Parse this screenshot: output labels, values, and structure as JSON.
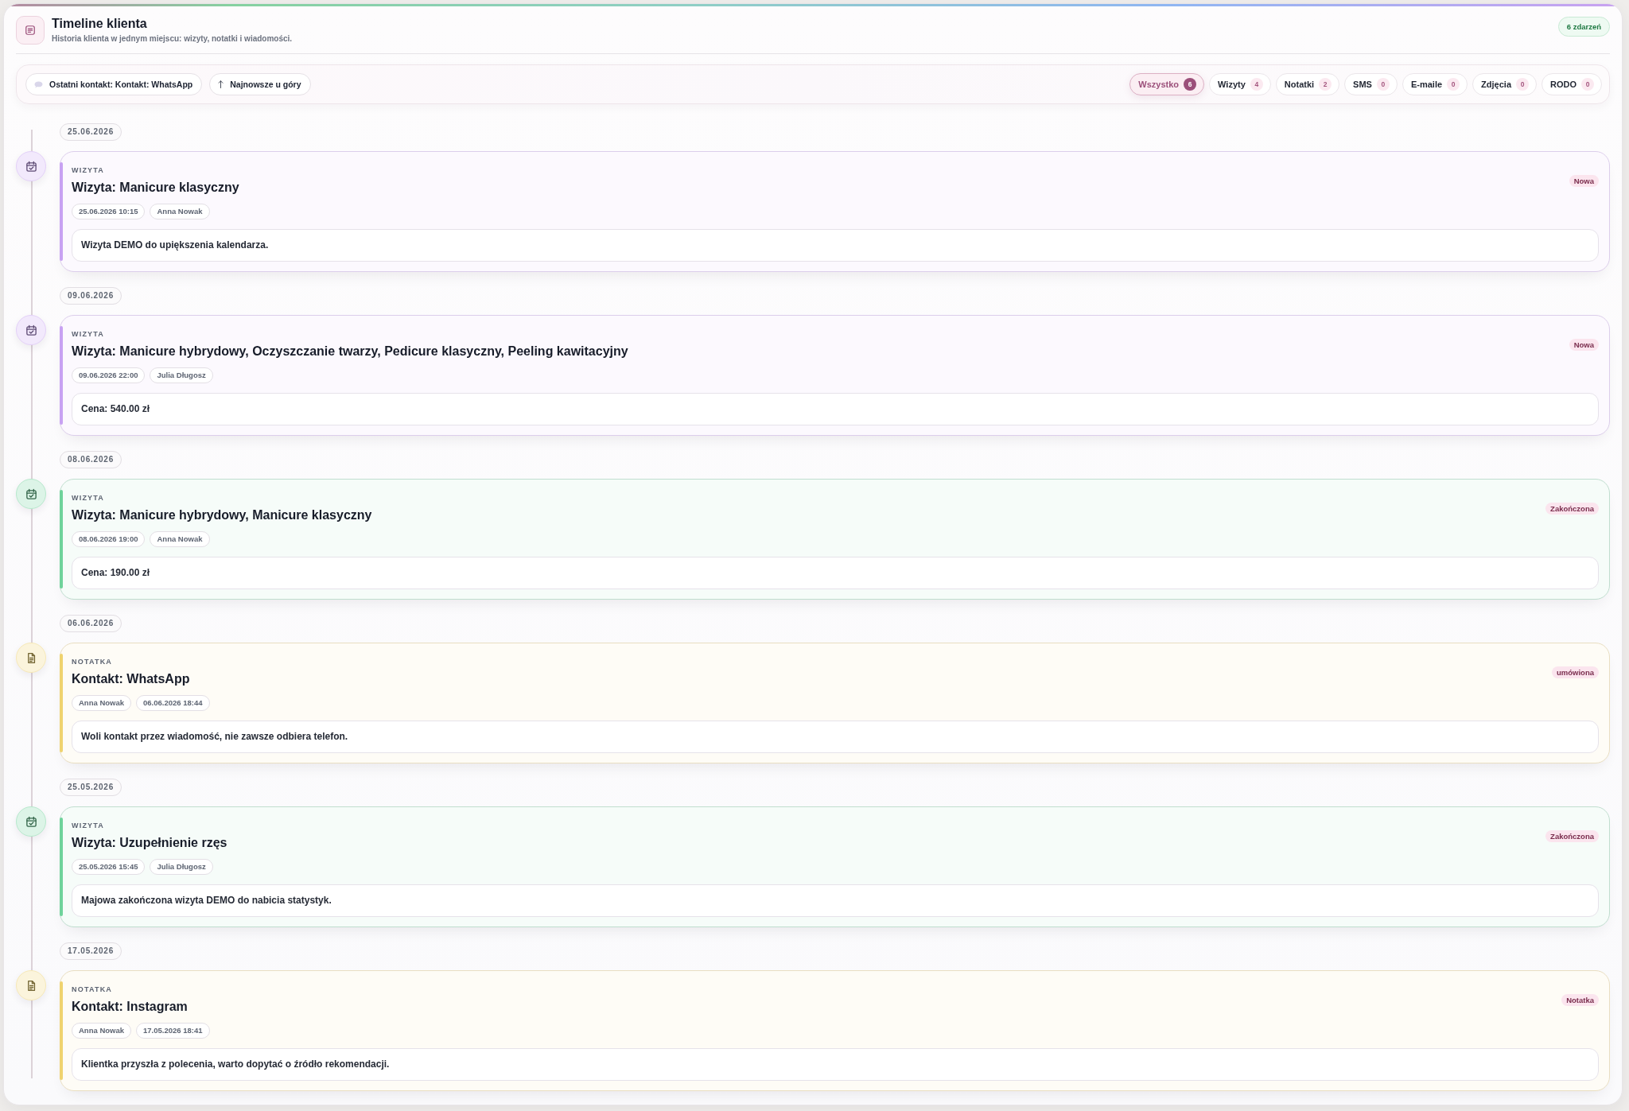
{
  "header": {
    "title": "Timeline klienta",
    "subtitle": "Historia klienta w jednym miejscu: wizyty, notatki i wiadomości.",
    "count_badge": "6 zdarzeń"
  },
  "toolbar": {
    "last_contact": "Ostatni kontakt: Kontakt: WhatsApp",
    "sort": "Najnowsze u góry",
    "filters": [
      {
        "label": "Wszystko",
        "count": "6",
        "selected": true
      },
      {
        "label": "Wizyty",
        "count": "4",
        "selected": false
      },
      {
        "label": "Notatki",
        "count": "2",
        "selected": false
      },
      {
        "label": "SMS",
        "count": "0",
        "selected": false
      },
      {
        "label": "E-maile",
        "count": "0",
        "selected": false
      },
      {
        "label": "Zdjęcia",
        "count": "0",
        "selected": false
      },
      {
        "label": "RODO",
        "count": "0",
        "selected": false
      }
    ]
  },
  "timeline": [
    {
      "date": "25.06.2026",
      "kind": "visit",
      "type_label": "WIZYTA",
      "title": "Wizyta: Manicure klasyczny",
      "status": "Nowa",
      "color": "#c8a2f2",
      "chips": [
        "25.06.2026 10:15",
        "Anna Nowak"
      ],
      "body": "Wizyta DEMO do upiększenia kalendarza."
    },
    {
      "date": "09.06.2026",
      "kind": "visit",
      "type_label": "WIZYTA",
      "title": "Wizyta: Manicure hybrydowy, Oczyszczanie twarzy, Pedicure klasyczny, Peeling kawitacyjny",
      "status": "Nowa",
      "color": "#c8a2f2",
      "chips": [
        "09.06.2026 22:00",
        "Julia Długosz"
      ],
      "body": "Cena: 540.00 zł"
    },
    {
      "date": "08.06.2026",
      "kind": "visit",
      "type_label": "WIZYTA",
      "title": "Wizyta: Manicure hybrydowy, Manicure klasyczny",
      "status": "Zakończona",
      "color": "#6fd39b",
      "chips": [
        "08.06.2026 19:00",
        "Anna Nowak"
      ],
      "body": "Cena: 190.00 zł"
    },
    {
      "date": "06.06.2026",
      "kind": "note",
      "type_label": "NOTATKA",
      "title": "Kontakt: WhatsApp",
      "status": "umówiona",
      "color": "#efd36f",
      "chips": [
        "Anna Nowak",
        "06.06.2026 18:44"
      ],
      "body": "Woli kontakt przez wiadomość, nie zawsze odbiera telefon."
    },
    {
      "date": "25.05.2026",
      "kind": "visit",
      "type_label": "WIZYTA",
      "title": "Wizyta: Uzupełnienie rzęs",
      "status": "Zakończona",
      "color": "#6fd39b",
      "chips": [
        "25.05.2026 15:45",
        "Julia Długosz"
      ],
      "body": "Majowa zakończona wizyta DEMO do nabicia statystyk."
    },
    {
      "date": "17.05.2026",
      "kind": "note",
      "type_label": "NOTATKA",
      "title": "Kontakt: Instagram",
      "status": "Notatka",
      "color": "#efd36f",
      "chips": [
        "Anna Nowak",
        "17.05.2026 18:41"
      ],
      "body": "Klientka przyszła z polecenia, warto dopytać o źródło rekomendacji."
    }
  ]
}
